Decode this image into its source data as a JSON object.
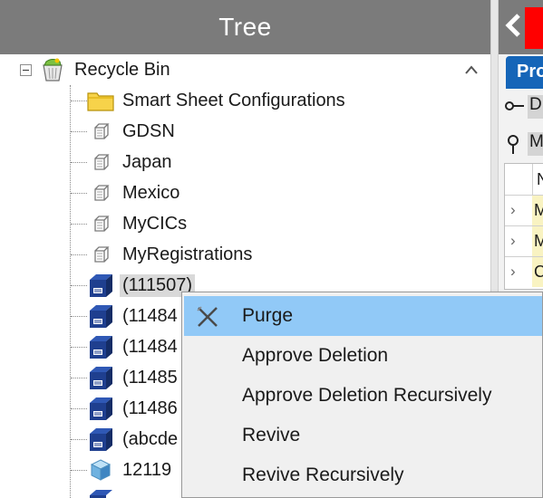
{
  "tree": {
    "title": "Tree",
    "items": [
      {
        "label": "Recycle Bin",
        "icon": "recycle-bin-icon"
      },
      {
        "label": "Smart Sheet Configurations",
        "icon": "folder-icon"
      },
      {
        "label": "GDSN",
        "icon": "cube-outline-icon"
      },
      {
        "label": "Japan",
        "icon": "cube-outline-icon"
      },
      {
        "label": "Mexico",
        "icon": "cube-outline-icon"
      },
      {
        "label": "MyCICs",
        "icon": "cube-outline-icon"
      },
      {
        "label": "MyRegistrations",
        "icon": "cube-outline-icon"
      },
      {
        "label": "(111507)",
        "icon": "blue-product-icon",
        "selected": true
      },
      {
        "label": "(11484",
        "icon": "blue-product-icon"
      },
      {
        "label": "(11484",
        "icon": "blue-product-icon"
      },
      {
        "label": "(11485",
        "icon": "blue-product-icon"
      },
      {
        "label": "(11486",
        "icon": "blue-product-icon"
      },
      {
        "label": "(abcde",
        "icon": "blue-product-icon"
      },
      {
        "label": "12119",
        "icon": "cube-3d-icon"
      }
    ]
  },
  "right_panel": {
    "tab_label": "Pro",
    "rows": [
      "D",
      "M"
    ],
    "table_header": "N",
    "table_rows": [
      "M",
      "M",
      "C"
    ]
  },
  "context_menu": {
    "items": [
      {
        "label": "Purge",
        "icon": "purge-x-icon",
        "highlighted": true
      },
      {
        "label": "Approve Deletion"
      },
      {
        "label": "Approve Deletion Recursively"
      },
      {
        "label": "Revive"
      },
      {
        "label": "Revive Recursively"
      }
    ]
  },
  "colors": {
    "header_bg": "#7b7b7b",
    "menu_highlight": "#91c9f7",
    "tab_blue": "#1565b8",
    "product_blue": "#1f3f8f",
    "accent_red": "#ff0000"
  }
}
